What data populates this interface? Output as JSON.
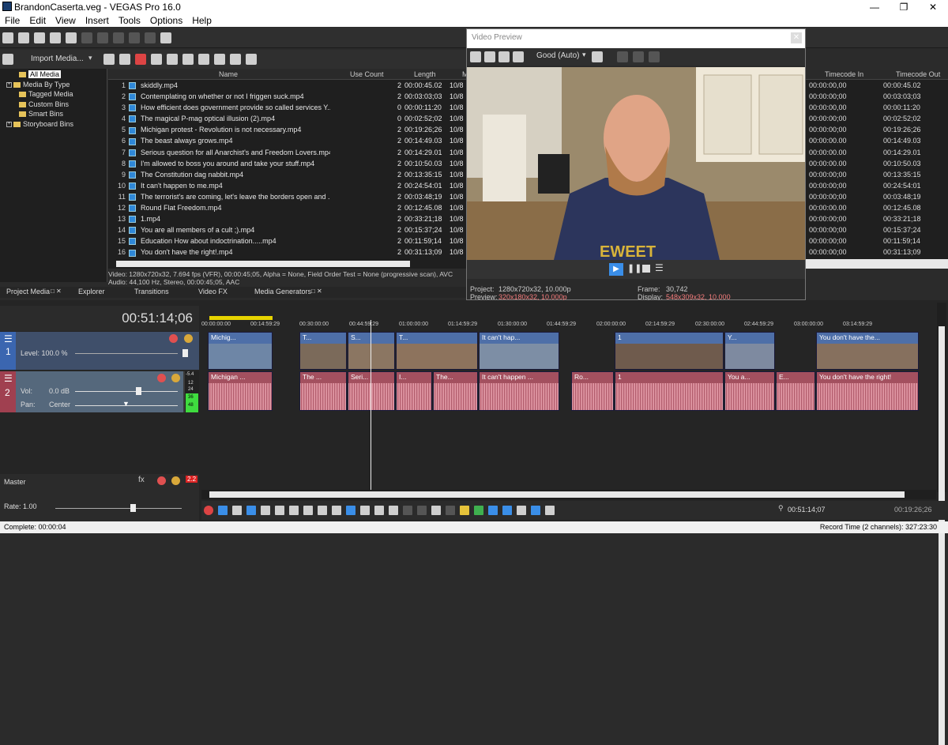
{
  "titlebar": {
    "title": "BrandonCaserta.veg - VEGAS Pro 16.0"
  },
  "menu": [
    "File",
    "Edit",
    "View",
    "Insert",
    "Tools",
    "Options",
    "Help"
  ],
  "project_media": {
    "import_label": "Import Media...",
    "tree": [
      {
        "label": "All Media",
        "expand": ""
      },
      {
        "label": "Media By Type",
        "expand": "+"
      },
      {
        "label": "Tagged Media",
        "expand": ""
      },
      {
        "label": "Custom Bins",
        "expand": ""
      },
      {
        "label": "Smart Bins",
        "expand": ""
      },
      {
        "label": "Storyboard Bins",
        "expand": "+"
      }
    ],
    "columns": {
      "name": "Name",
      "use_count": "Use Count",
      "length": "Length",
      "m": "M",
      "tc_in": "Timecode In",
      "tc_out": "Timecode Out"
    },
    "rows": [
      {
        "n": "1",
        "name": "skiddly.mp4",
        "use": "2",
        "len": "00:00:45.02",
        "m": "10/8",
        "tcin": "00:00:00,00",
        "tcout": "00:00:45.02"
      },
      {
        "n": "2",
        "name": "Contemplating on whether or not I friggen suck.mp4",
        "use": "2",
        "len": "00:03:03;03",
        "m": "10/8",
        "tcin": "00:00:00;00",
        "tcout": "00:03:03;03"
      },
      {
        "n": "3",
        "name": "How efficient does government provide so called  services  Y...",
        "use": "0",
        "len": "00:00:11:20",
        "m": "10/8",
        "tcin": "00:00:00,00",
        "tcout": "00:00:11:20"
      },
      {
        "n": "4",
        "name": "The magical P-mag optical illusion (2).mp4",
        "use": "0",
        "len": "00:02:52;02",
        "m": "10/8",
        "tcin": "00:00:00;00",
        "tcout": "00:02:52;02"
      },
      {
        "n": "5",
        "name": "Michigan protest - Revolution is not necessary.mp4",
        "use": "2",
        "len": "00:19:26;26",
        "m": "10/8",
        "tcin": "00:00:00;00",
        "tcout": "00:19:26;26"
      },
      {
        "n": "6",
        "name": "The beast always grows.mp4",
        "use": "2",
        "len": "00:14:49.03",
        "m": "10/8",
        "tcin": "00:00:00.00",
        "tcout": "00:14:49.03"
      },
      {
        "n": "7",
        "name": "Serious question for all Anarchist's and Freedom Lovers.mp4",
        "use": "2",
        "len": "00:14:29.01",
        "m": "10/8",
        "tcin": "00:00:00.00",
        "tcout": "00:14:29.01"
      },
      {
        "n": "8",
        "name": "I'm allowed to boss you around and take your stuff.mp4",
        "use": "2",
        "len": "00:10:50.03",
        "m": "10/8",
        "tcin": "00:00:00.00",
        "tcout": "00:10:50.03"
      },
      {
        "n": "9",
        "name": "The Constitution dag nabbit.mp4",
        "use": "2",
        "len": "00:13:35:15",
        "m": "10/8",
        "tcin": "00:00:00;00",
        "tcout": "00:13:35:15"
      },
      {
        "n": "10",
        "name": "It can't happen to me.mp4",
        "use": "2",
        "len": "00:24:54:01",
        "m": "10/8",
        "tcin": "00:00:00;00",
        "tcout": "00:24:54:01"
      },
      {
        "n": "11",
        "name": "The terrorist's are coming, let's leave the borders open and ...",
        "use": "2",
        "len": "00:03:48;19",
        "m": "10/8",
        "tcin": "00:00:00;00",
        "tcout": "00:03:48;19"
      },
      {
        "n": "12",
        "name": "Round Flat Freedom.mp4",
        "use": "2",
        "len": "00:12:45.08",
        "m": "10/8",
        "tcin": "00:00:00.00",
        "tcout": "00:12:45.08"
      },
      {
        "n": "13",
        "name": "1.mp4",
        "use": "2",
        "len": "00:33:21;18",
        "m": "10/8",
        "tcin": "00:00:00;00",
        "tcout": "00:33:21;18"
      },
      {
        "n": "14",
        "name": "You are all members of a cult ;).mp4",
        "use": "2",
        "len": "00:15:37;24",
        "m": "10/8",
        "tcin": "00:00:00;00",
        "tcout": "00:15:37;24"
      },
      {
        "n": "15",
        "name": "Education How about indoctrination.....mp4",
        "use": "2",
        "len": "00:11:59;14",
        "m": "10/8",
        "tcin": "00:00:00;00",
        "tcout": "00:11:59;14"
      },
      {
        "n": "16",
        "name": "You don't have the right!.mp4",
        "use": "2",
        "len": "00:31:13;09",
        "m": "10/8",
        "tcin": "00:00:00;00",
        "tcout": "00:31:13;09"
      }
    ],
    "info_video": "Video: 1280x720x32, 7.694 fps (VFR), 00:00:45;05, Alpha = None, Field Order Test = None (progressive scan), AVC",
    "info_audio": "Audio: 44,100 Hz, Stereo, 00:00:45;05, AAC"
  },
  "tabs": [
    "Project Media",
    "Explorer",
    "Transitions",
    "Video FX",
    "Media Generators"
  ],
  "preview": {
    "title": "Video Preview",
    "quality": "Good (Auto)",
    "project_label": "Project:",
    "project_val": "1280x720x32, 10.000p",
    "preview_label": "Preview:",
    "preview_val": "320x180x32, 10.000p",
    "frame_label": "Frame:",
    "frame_val": "30,742",
    "display_label": "Display:",
    "display_val": "548x309x32, 10.000"
  },
  "timeline": {
    "time": "00:51:14;06",
    "ruler": [
      "00:00:00:00",
      "00:14:59:29",
      "00:30:00:00",
      "00:44:59:29",
      "01:00:00:00",
      "01:14:59:29",
      "01:30:00:00",
      "01:44:59:29",
      "02:00:00:00",
      "02:14:59:29",
      "02:30:00:00",
      "02:44:59:29",
      "03:00:00:00",
      "03:14:59:29"
    ],
    "video_track": {
      "num": "1",
      "level": "Level: 100.0 %"
    },
    "audio_track": {
      "num": "2",
      "vol_label": "Vol:",
      "vol": "0.0 dB",
      "pan_label": "Pan:",
      "pan": "Center",
      "meter": [
        "-5.4",
        "12",
        "24",
        "36",
        "48"
      ]
    },
    "video_clips": [
      "Michig...",
      "T...",
      "S...",
      "T...",
      "It can't hap...",
      "1",
      "Y...",
      "You don't have the..."
    ],
    "audio_clips": [
      "Michigan ...",
      "The ...",
      "Seri...",
      "I...",
      "The...",
      "It can't happen ...",
      "Ro...",
      "1",
      "You a...",
      "E...",
      "You don't have the right!"
    ],
    "master_label": "Master",
    "master_peak": "2.2",
    "rate": "Rate: 1.00",
    "cursor_time": "00:51:14;07",
    "end_time": "00:19:26;26"
  },
  "status": {
    "left": "Complete: 00:00:04",
    "right": "Record Time (2 channels): 327:23:30"
  }
}
